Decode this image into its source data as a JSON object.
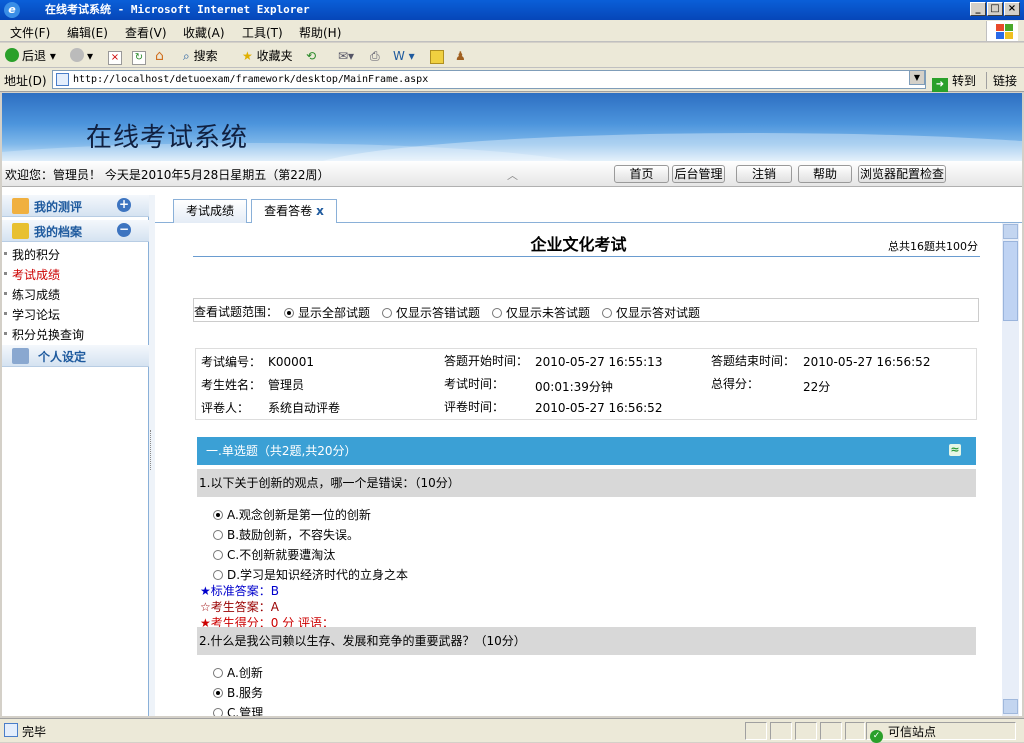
{
  "window": {
    "title": "在线考试系统 - Microsoft Internet Explorer",
    "min": "_",
    "max": "□",
    "close": "×"
  },
  "menu": [
    "文件(F)",
    "编辑(E)",
    "查看(V)",
    "收藏(A)",
    "工具(T)",
    "帮助(H)"
  ],
  "toolbar": {
    "back": "后退",
    "search": "搜索",
    "favorites": "收藏夹"
  },
  "address": {
    "label": "地址(D)",
    "url": "http://localhost/detuoexam/framework/desktop/MainFrame.aspx",
    "go": "转到",
    "links": "链接"
  },
  "banner": {
    "title": "在线考试系统"
  },
  "infobar": {
    "welcome": "欢迎您：管理员！  今天是2010年5月28日星期五（第22周）",
    "buttons": [
      "首页",
      "后台管理",
      "注销",
      "帮助",
      "浏览器配置检查"
    ]
  },
  "sidebar": {
    "sections": [
      {
        "label": "我的测评",
        "toggle": "+"
      },
      {
        "label": "我的档案",
        "toggle": "−"
      }
    ],
    "items": [
      {
        "label": "我的积分",
        "color": "#000000"
      },
      {
        "label": "考试成绩",
        "color": "#cc0000"
      },
      {
        "label": "练习成绩",
        "color": "#000000"
      },
      {
        "label": "学习论坛",
        "color": "#000000"
      },
      {
        "label": "积分兑换查询",
        "color": "#000000"
      }
    ],
    "settings": "个人设定"
  },
  "tabs": [
    {
      "label": "考试成绩"
    },
    {
      "label": "查看答卷",
      "close": "x"
    }
  ],
  "exam": {
    "title": "企业文化考试",
    "total": "总共16题共100分",
    "range_label": "查看试题范围：",
    "range_options": [
      "显示全部试题",
      "仅显示答错试题",
      "仅显示未答试题",
      "仅显示答对试题"
    ],
    "info": {
      "exam_no_label": "考试编号：",
      "exam_no": "K00001",
      "start_label": "答题开始时间：",
      "start": "2010-05-27 16:55:13",
      "end_label": "答题结束时间：",
      "end": "2010-05-27 16:56:52",
      "name_label": "考生姓名：",
      "name": "管理员",
      "duration_label": "考试时间：",
      "duration": "00:01:39分钟",
      "score_label": "总得分：",
      "score": "22分",
      "grader_label": "评卷人：",
      "grader": "系统自动评卷",
      "grade_time_label": "评卷时间：",
      "grade_time": "2010-05-27 16:56:52"
    },
    "section": {
      "title": "一.单选题（共2题,共20分）",
      "collapse": "≈"
    },
    "q1": {
      "text": "1.以下关于创新的观点，哪一个是错误：（10分）",
      "options": [
        "A.观念创新是第一位的创新",
        "B.鼓励创新，不容失误。",
        "C.不创新就要遭淘汰",
        "D.学习是知识经济时代的立身之本"
      ],
      "selected": 0,
      "std_label": "★标准答案：",
      "std": "B",
      "user_label": "☆考生答案：",
      "user": "A",
      "score_label": "★考生得分：",
      "score": "0 分  评语："
    },
    "q2": {
      "text": "2.什么是我公司赖以生存、发展和竞争的重要武器？（10分）",
      "options": [
        "A.创新",
        "B.服务",
        "C.管理"
      ],
      "selected": 1
    }
  },
  "status": {
    "text": "完毕",
    "zone": "可信站点"
  }
}
